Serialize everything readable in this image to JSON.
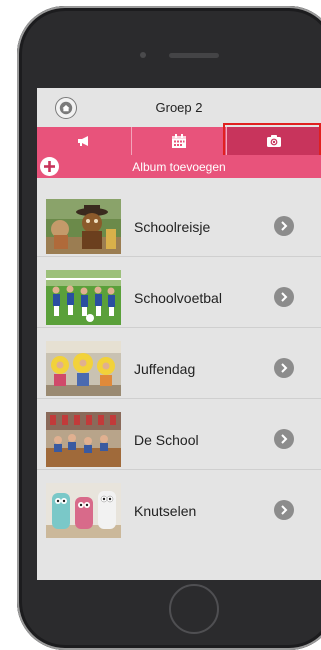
{
  "header": {
    "title": "Groep 2",
    "home_icon": "home-icon"
  },
  "tabs": [
    {
      "name": "announcements",
      "icon": "megaphone-icon",
      "active": false
    },
    {
      "name": "calendar",
      "icon": "calendar-icon",
      "active": false
    },
    {
      "name": "photos",
      "icon": "camera-icon",
      "active": true
    }
  ],
  "add_album": {
    "label": "Album toevoegen",
    "icon": "plus-circle-icon"
  },
  "albums": [
    {
      "label": "Schoolreisje"
    },
    {
      "label": "Schoolvoetbal"
    },
    {
      "label": "Juffendag"
    },
    {
      "label": "De School"
    },
    {
      "label": "Knutselen"
    }
  ],
  "colors": {
    "accent": "#e8537b",
    "accent_active": "#c8345c",
    "highlight": "#e02020",
    "background": "#e4e4e4"
  }
}
